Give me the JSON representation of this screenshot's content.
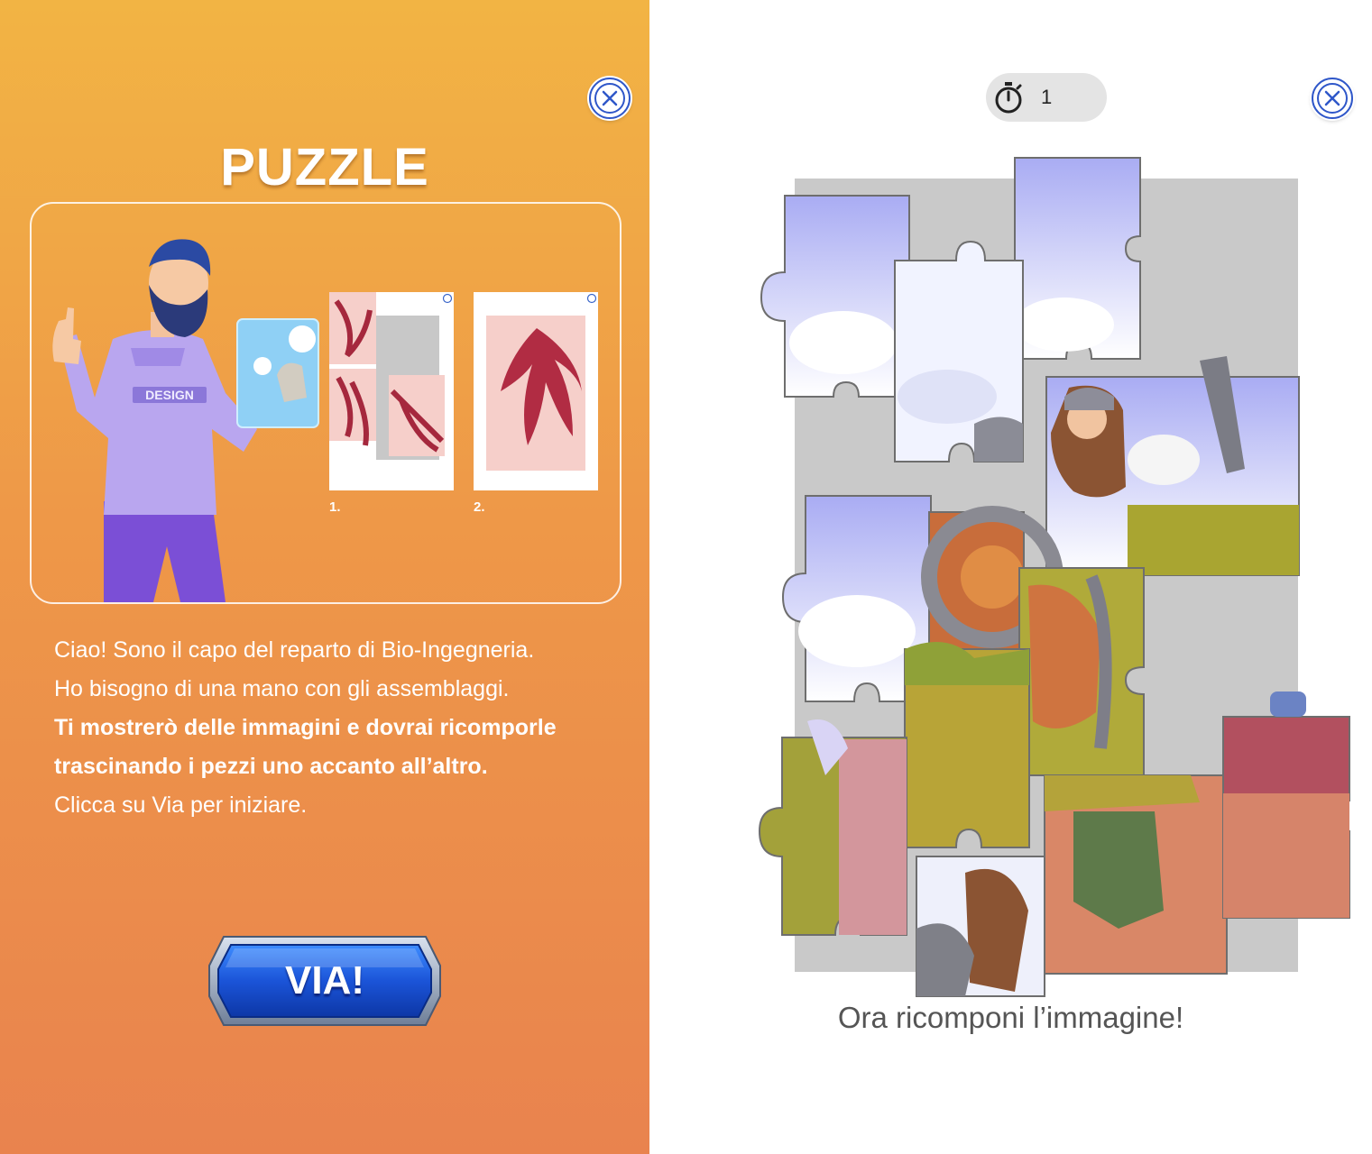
{
  "intro": {
    "title": "PUZZLE",
    "close_icon": "close-icon",
    "illustration": {
      "shirt_text": "DESIGN",
      "step_1": "1.",
      "step_2": "2."
    },
    "text": {
      "line_1": "Ciao! Sono il capo del reparto di Bio-Ingegneria.",
      "line_2": "Ho bisogno di una mano con gli assemblaggi.",
      "line_3": "Ti mostrerò delle immagini e dovrai ricomporle",
      "line_4": "trascinando i pezzi uno accanto all’altro.",
      "line_5": "Clicca su Via per iniziare."
    },
    "start_button": "VIA!"
  },
  "game": {
    "timer_icon": "stopwatch-icon",
    "timer_value": "1",
    "close_icon": "close-icon",
    "caption": "Ora ricomponi l’immagine!"
  },
  "colors": {
    "panel_top": "#f2b444",
    "panel_bottom": "#e9834e",
    "button_blue": "#1f5be0",
    "close_blue": "#2f57c9",
    "board_grey": "#c9c9c9"
  }
}
